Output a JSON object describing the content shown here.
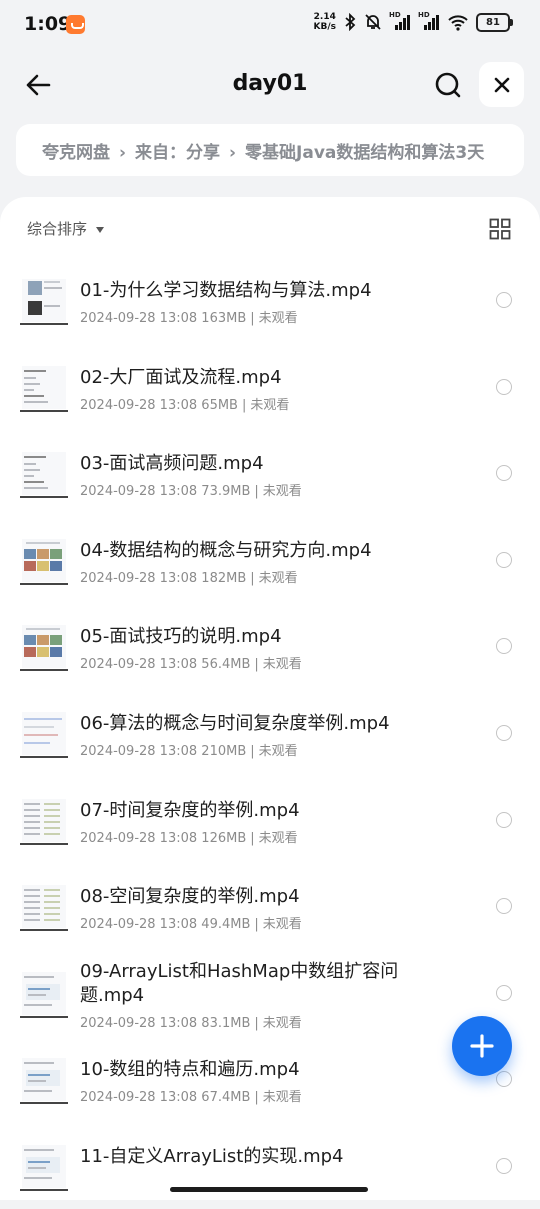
{
  "status_bar": {
    "time": "1:09",
    "speed_value": "2.14",
    "speed_unit": "KB/s",
    "signal1_label": "HD",
    "signal2_label": "HD",
    "battery": "81"
  },
  "header": {
    "title": "day01",
    "back_icon": "arrow-left-icon",
    "search_icon": "search-icon",
    "close_icon": "close-icon"
  },
  "breadcrumb": {
    "items": [
      "夸克网盘",
      "来自：分享",
      "零基础Java数据结构和算法3天"
    ],
    "separator": "›"
  },
  "toolbar": {
    "sort_label": "综合排序",
    "view_icon": "grid-view-icon"
  },
  "files": [
    {
      "name": "01-为什么学习数据结构与算法.mp4",
      "date": "2024-09-28 13:08",
      "size": "163MB",
      "status": "未观看"
    },
    {
      "name": "02-大厂面试及流程.mp4",
      "date": "2024-09-28 13:08",
      "size": "65MB",
      "status": "未观看"
    },
    {
      "name": "03-面试高频问题.mp4",
      "date": "2024-09-28 13:08",
      "size": "73.9MB",
      "status": "未观看"
    },
    {
      "name": "04-数据结构的概念与研究方向.mp4",
      "date": "2024-09-28 13:08",
      "size": "182MB",
      "status": "未观看"
    },
    {
      "name": "05-面试技巧的说明.mp4",
      "date": "2024-09-28 13:08",
      "size": "56.4MB",
      "status": "未观看"
    },
    {
      "name": "06-算法的概念与时间复杂度举例.mp4",
      "date": "2024-09-28 13:08",
      "size": "210MB",
      "status": "未观看"
    },
    {
      "name": "07-时间复杂度的举例.mp4",
      "date": "2024-09-28 13:08",
      "size": "126MB",
      "status": "未观看"
    },
    {
      "name": "08-空间复杂度的举例.mp4",
      "date": "2024-09-28 13:08",
      "size": "49.4MB",
      "status": "未观看"
    },
    {
      "name": "09-ArrayList和HashMap中数组扩容问题.mp4",
      "date": "2024-09-28 13:08",
      "size": "83.1MB",
      "status": "未观看"
    },
    {
      "name": "10-数组的特点和遍历.mp4",
      "date": "2024-09-28 13:08",
      "size": "67.4MB",
      "status": "未观看"
    },
    {
      "name": "11-自定义ArrayList的实现.mp4",
      "date": "",
      "size": "",
      "status": ""
    }
  ],
  "fab": {
    "icon": "plus-icon"
  },
  "colors": {
    "accent": "#1a73f0",
    "background": "#f2f3f5",
    "app_badge": "#ff7a2f"
  }
}
